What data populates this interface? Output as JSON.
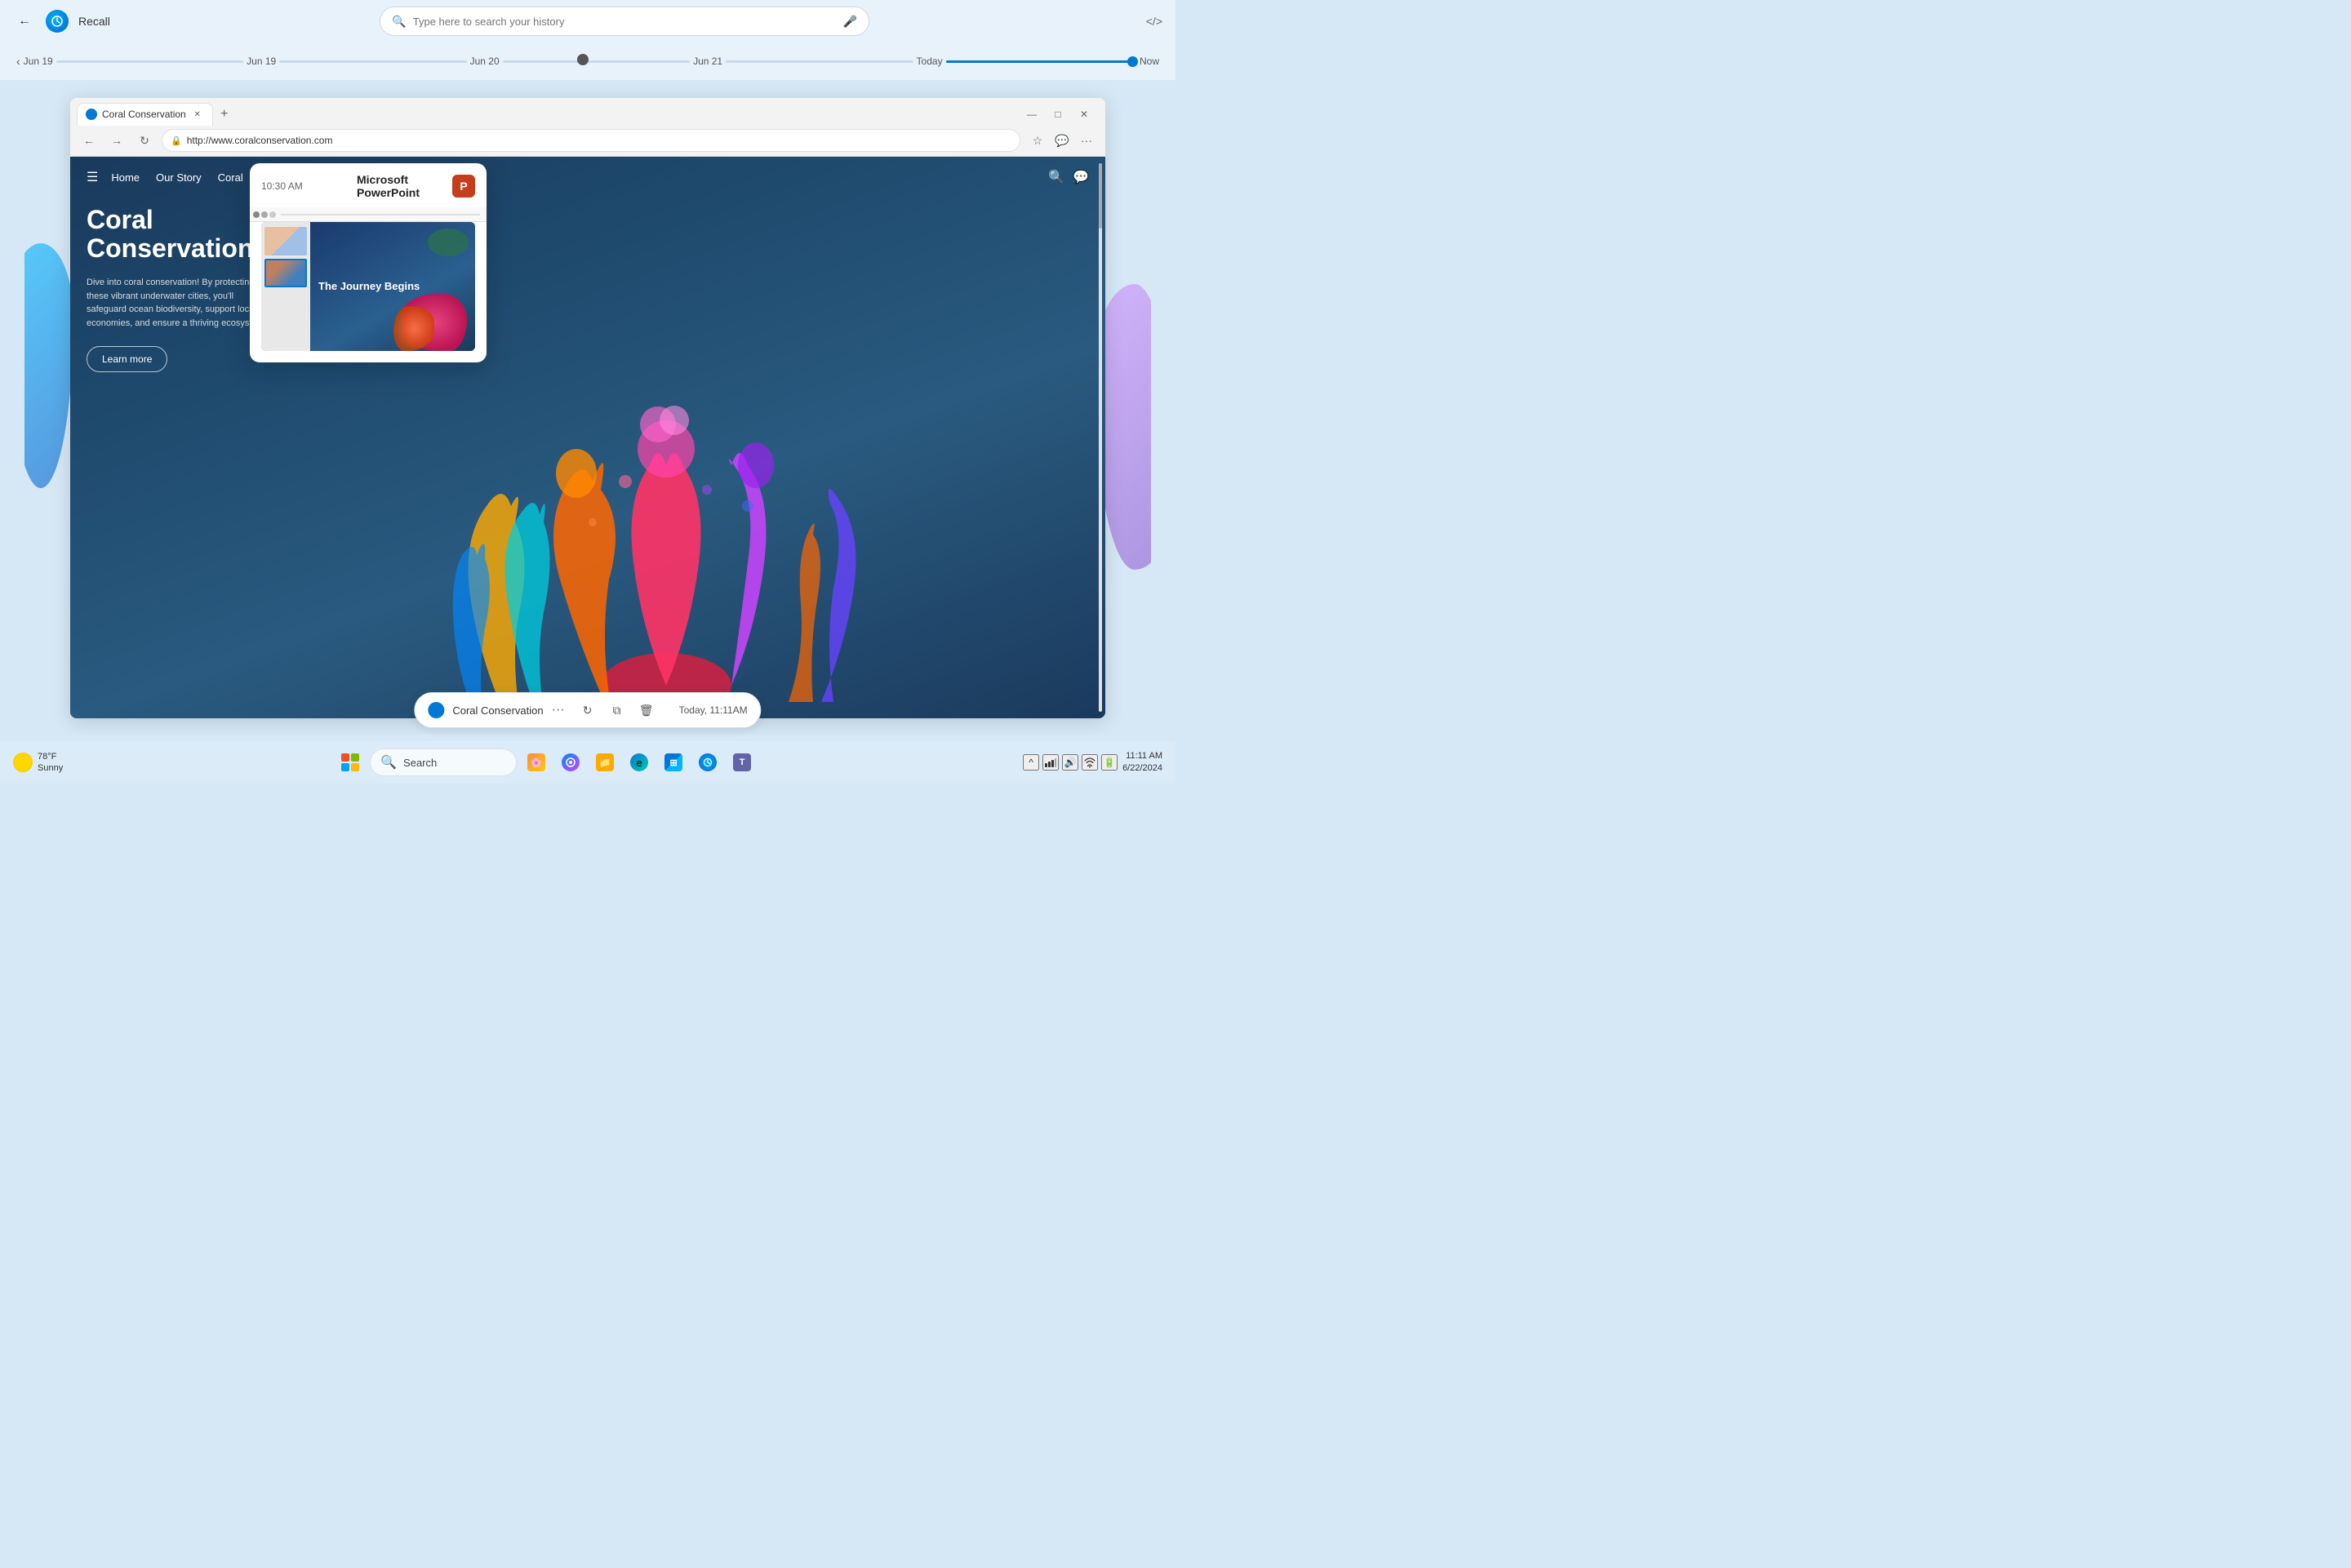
{
  "app": {
    "title": "Recall",
    "logo": "↺"
  },
  "recall_bar": {
    "back_label": "←",
    "search_placeholder": "Type here to search your history",
    "mic_label": "🎤",
    "code_label": "</>",
    "title": "Recall"
  },
  "timeline": {
    "prev_label": "‹",
    "labels": [
      "Jun 19",
      "Jun 19",
      "Jun 20",
      "Jun 21",
      "Today",
      "Now"
    ]
  },
  "browser": {
    "tab_title": "Coral Conservation",
    "url": "http://www.coralconservation.com",
    "window_min": "—",
    "window_max": "□",
    "window_close": "✕"
  },
  "website": {
    "nav_links": [
      "Home",
      "Our Story",
      "Coral"
    ],
    "hero_title": "Coral\nConservation",
    "hero_desc": "Dive into coral conservation! By protecting these vibrant underwater cities, you'll safeguard ocean biodiversity, support local economies, and ensure a thriving ecosystem.",
    "cta_label": "Learn more"
  },
  "ppt_popup": {
    "time": "10:30 AM",
    "app_title": "Microsoft PowerPoint",
    "app_icon_letter": "P",
    "slide_text": "The Journey Begins"
  },
  "snapshot_bar": {
    "title": "Coral Conservation",
    "more_label": "···",
    "refresh_label": "↻",
    "copy_label": "⧉",
    "delete_label": "🗑",
    "timestamp": "Today, 11:11AM"
  },
  "taskbar": {
    "weather_temp": "78°F",
    "weather_condition": "Sunny",
    "search_label": "Search",
    "win_btn_label": "⊞",
    "clock_time": "11:11 AM",
    "clock_date": "6/22/2024"
  }
}
